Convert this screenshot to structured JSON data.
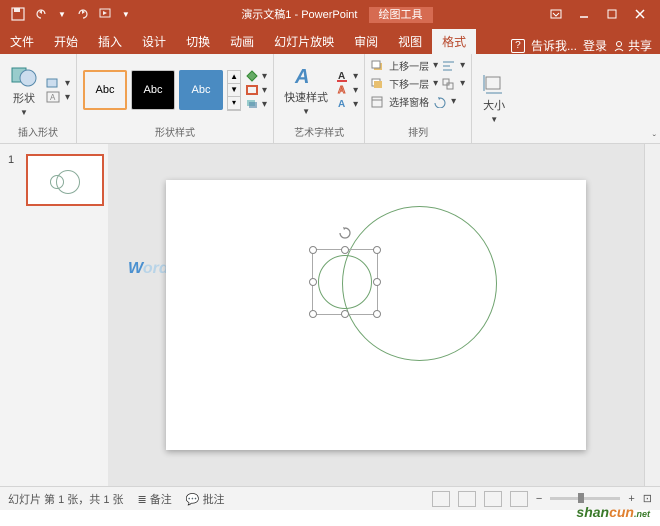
{
  "titlebar": {
    "doc_title": "演示文稿1 - PowerPoint",
    "context_tab": "绘图工具"
  },
  "tabs": {
    "file": "文件",
    "home": "开始",
    "insert": "插入",
    "design": "设计",
    "transitions": "切换",
    "animations": "动画",
    "slideshow": "幻灯片放映",
    "review": "审阅",
    "view": "视图",
    "format": "格式",
    "tell_me": "告诉我...",
    "signin": "登录",
    "share": "共享"
  },
  "ribbon": {
    "insert_shapes": {
      "shapes": "形状",
      "label": "插入形状"
    },
    "shape_styles": {
      "sample": "Abc",
      "label": "形状样式"
    },
    "wordart_styles": {
      "quick_styles": "快速样式",
      "label": "艺术字样式"
    },
    "arrange": {
      "bring_forward": "上移一层",
      "send_backward": "下移一层",
      "selection_pane": "选择窗格",
      "label": "排列"
    },
    "size": {
      "size": "大小",
      "label": ""
    }
  },
  "thumbnails": {
    "slide1_num": "1"
  },
  "statusbar": {
    "slide_info": "幻灯片 第 1 张，共 1 张",
    "notes": "备注",
    "comments": "批注"
  },
  "watermark": {
    "prefix": "W",
    "suffix": "ord 联盟"
  },
  "brand": {
    "text1": "shan",
    "text2": "cun",
    "text3": ".net"
  }
}
